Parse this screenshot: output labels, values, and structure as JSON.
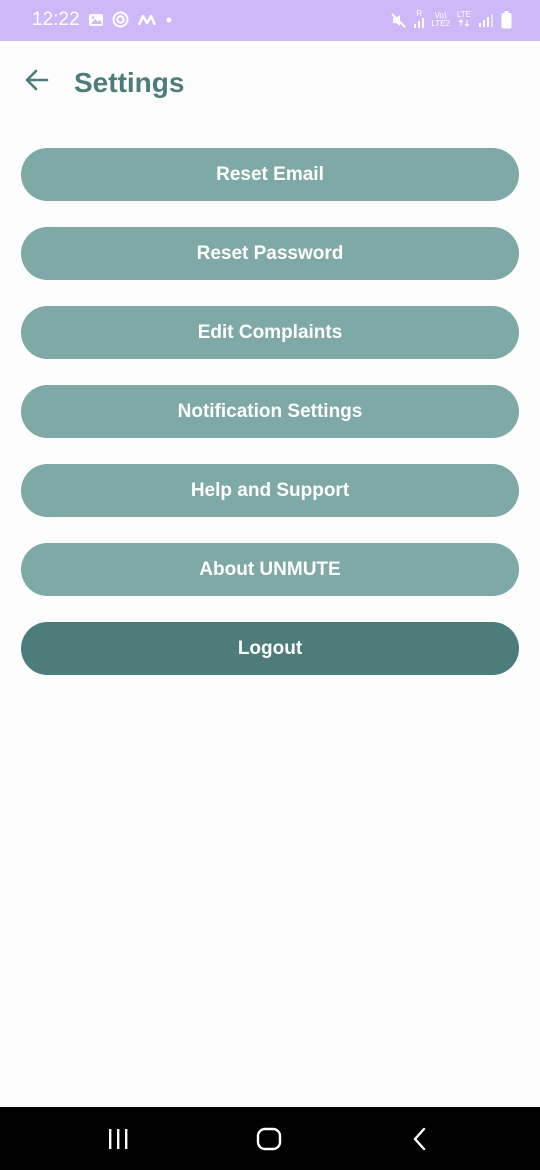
{
  "status_bar": {
    "time": "12:22",
    "network_label_top": "Vo)",
    "network_label_bottom": "LTE2",
    "lte_label": "LTE",
    "signal_label": "R"
  },
  "header": {
    "title": "Settings"
  },
  "menu": {
    "items": [
      {
        "label": "Reset Email"
      },
      {
        "label": "Reset Password"
      },
      {
        "label": "Edit Complaints"
      },
      {
        "label": "Notification Settings"
      },
      {
        "label": "Help and Support"
      },
      {
        "label": "About UNMUTE"
      },
      {
        "label": "Logout"
      }
    ]
  },
  "colors": {
    "status_bar": "#cdb8f8",
    "accent": "#4c7d7b",
    "button": "#7ea9a7",
    "background": "#fdfdfd"
  },
  "icons": {
    "back": "arrow-left-icon",
    "recents": "recents-icon",
    "home": "home-icon",
    "nav_back": "chevron-left-icon"
  }
}
